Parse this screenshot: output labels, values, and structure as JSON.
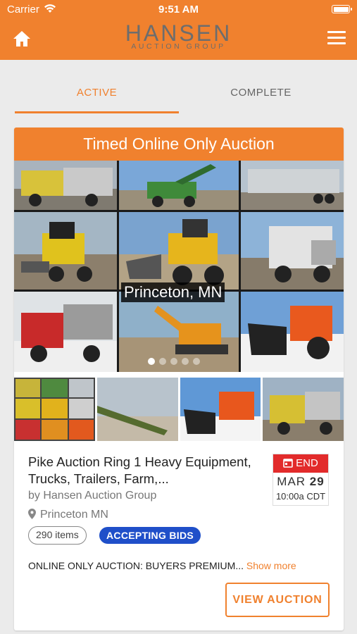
{
  "status_bar": {
    "carrier": "Carrier",
    "time": "9:51 AM"
  },
  "header": {
    "logo_main": "HANSEN",
    "logo_sub": "AUCTION GROUP",
    "home_icon": "home-icon",
    "menu_icon": "hamburger-menu-icon",
    "color": "#f0812e"
  },
  "tabs": [
    {
      "label": "ACTIVE",
      "selected": true
    },
    {
      "label": "COMPLETE",
      "selected": false
    }
  ],
  "auction": {
    "banner": "Timed Online Only Auction",
    "hero_location_label": "Princeton, MN",
    "carousel": {
      "slide_count": 5,
      "current_slide": 1
    },
    "title": "Pike Auction Ring 1 Heavy Equipment, Trucks, Trailers, Farm,...",
    "by": "by Hansen Auction Group",
    "location": "Princeton MN",
    "items_count": "290 items",
    "status_badge": "ACCEPTING BIDS",
    "end": {
      "label": "END",
      "month": "MAR",
      "day": "29",
      "time": "10:00a CDT"
    },
    "description": "ONLINE ONLY AUCTION: BUYERS PREMIUM...",
    "show_more": "Show more",
    "view_button": "VIEW AUCTION"
  },
  "colors": {
    "accent": "#f0812e",
    "badge_blue": "#1f4fc9",
    "end_red": "#e22b2b"
  }
}
